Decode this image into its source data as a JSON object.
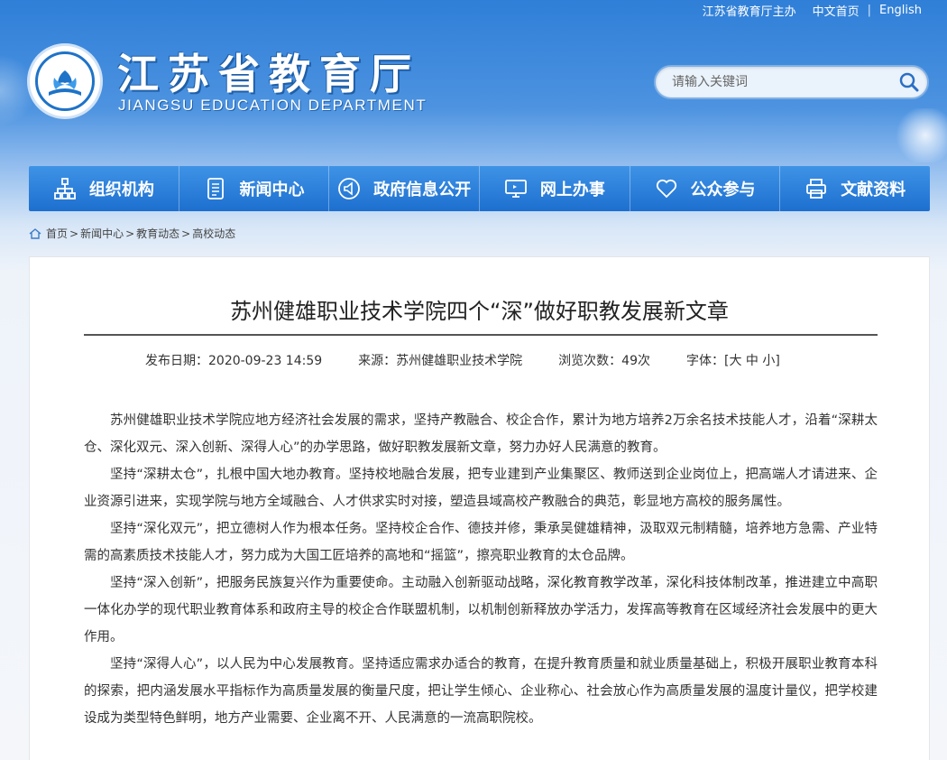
{
  "topbar": {
    "sponsor": "江苏省教育厅主办",
    "chinese": "中文首页",
    "english": "English"
  },
  "logo": {
    "title": "江苏省教育厅",
    "subtitle": "JIANGSU EDUCATION DEPARTMENT"
  },
  "search": {
    "placeholder": "请输入关键词"
  },
  "nav": [
    {
      "label": "组织机构",
      "icon": "org-chart-icon"
    },
    {
      "label": "新闻中心",
      "icon": "document-icon"
    },
    {
      "label": "政府信息公开",
      "icon": "speaker-icon"
    },
    {
      "label": "网上办事",
      "icon": "monitor-icon"
    },
    {
      "label": "公众参与",
      "icon": "heart-icon"
    },
    {
      "label": "文献资料",
      "icon": "printer-icon"
    }
  ],
  "breadcrumb": {
    "items": [
      "首页",
      "新闻中心",
      "教育动态",
      "高校动态"
    ],
    "separator": ">"
  },
  "article": {
    "title": "苏州健雄职业技术学院四个“深”做好职教发展新文章",
    "date": "发布日期：2020-09-23 14:59",
    "source": "来源：苏州健雄职业技术学院",
    "views": "浏览次数：49次",
    "font_label": "字体：[",
    "font_large": "大",
    "font_medium": "中",
    "font_small": "小",
    "font_close": "]",
    "paragraphs": [
      "苏州健雄职业技术学院应地方经济社会发展的需求，坚持产教融合、校企合作，累计为地方培养2万余名技术技能人才，沿着“深耕太仓、深化双元、深入创新、深得人心”的办学思路，做好职教发展新文章，努力办好人民满意的教育。",
      "坚持“深耕太仓”，扎根中国大地办教育。坚持校地融合发展，把专业建到产业集聚区、教师送到企业岗位上，把高端人才请进来、企业资源引进来，实现学院与地方全域融合、人才供求实时对接，塑造县域高校产教融合的典范，彰显地方高校的服务属性。",
      "坚持“深化双元”，把立德树人作为根本任务。坚持校企合作、德技并修，秉承吴健雄精神，汲取双元制精髓，培养地方急需、产业特需的高素质技术技能人才，努力成为大国工匠培养的高地和“摇篮”，擦亮职业教育的太仓品牌。",
      "坚持“深入创新”，把服务民族复兴作为重要使命。主动融入创新驱动战略，深化教育教学改革，深化科技体制改革，推进建立中高职一体化办学的现代职业教育体系和政府主导的校企合作联盟机制，以机制创新释放办学活力，发挥高等教育在区域经济社会发展中的更大作用。",
      "坚持“深得人心”，以人民为中心发展教育。坚持适应需求办适合的教育，在提升教育质量和就业质量基础上，积极开展职业教育本科的探索，把内涵发展水平指标作为高质量发展的衡量尺度，把让学生倾心、企业称心、社会放心作为高质量发展的温度计量仪，把学校建设成为类型特色鲜明，地方产业需要、企业离不开、人民满意的一流高职院校。"
    ]
  },
  "colors": {
    "nav": "#1d6fcf",
    "brand_blue": "#1e73c8"
  }
}
